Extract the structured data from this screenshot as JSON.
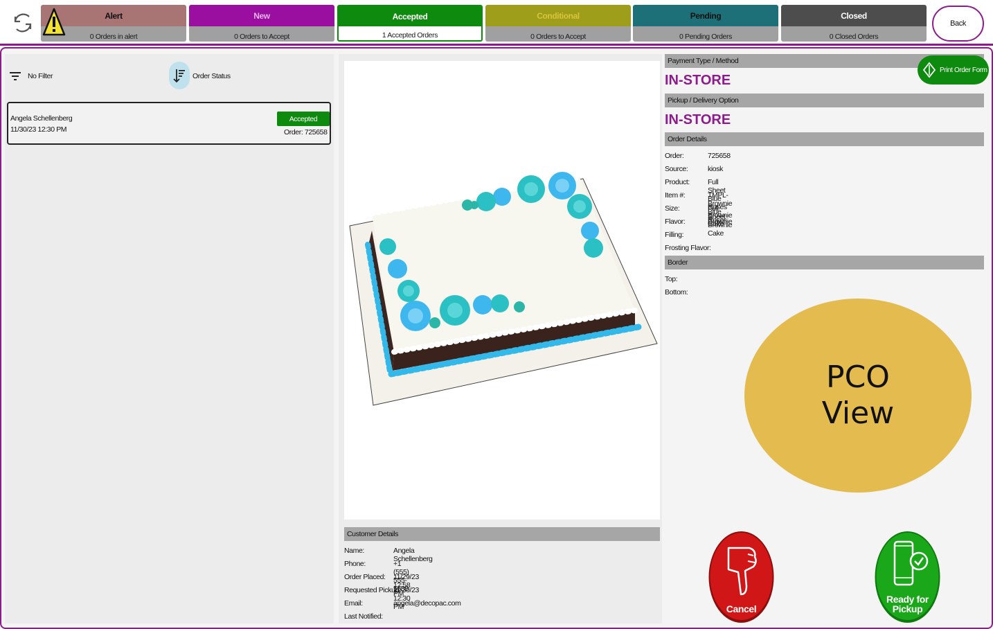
{
  "header": {
    "tiles": [
      {
        "title": "Alert",
        "subtitle": "0 Orders in alert"
      },
      {
        "title": "New",
        "subtitle": "0 Orders to Accept"
      },
      {
        "title": "Accepted",
        "subtitle": "1 Accepted Orders"
      },
      {
        "title": "Conditional",
        "subtitle": "0 Orders to Accept"
      },
      {
        "title": "Pending",
        "subtitle": "0 Pending Orders"
      },
      {
        "title": "Closed",
        "subtitle": "0 Closed Orders"
      }
    ],
    "back_label": "Back"
  },
  "filters": {
    "filter_label": "No Filter",
    "sort_label": "Order Status"
  },
  "order_list": [
    {
      "name": "Angela Schellenberg",
      "datetime": "11/30/23 12:30 PM",
      "status": "Accepted",
      "order_label": "Order: 725658"
    }
  ],
  "customer": {
    "section_title": "Customer Details",
    "rows": [
      {
        "label": "Name:",
        "value": "Angela Schellenberg"
      },
      {
        "label": "Phone:",
        "value": "+1 (555) 555-5555"
      },
      {
        "label": "Order Placed:",
        "value": "11/29/23 12:58 PM"
      },
      {
        "label": "Requested Pickup:",
        "value": "11/30/23 12:30 PM"
      },
      {
        "label": "Email:",
        "value": "angela@decopac.com"
      },
      {
        "label": "Last Notified:",
        "value": ""
      }
    ]
  },
  "details": {
    "payment_section": "Payment Type / Method",
    "payment_value": "IN-STORE",
    "pickup_section": "Pickup / Delivery Option",
    "pickup_value": "IN-STORE",
    "order_section": "Order Details",
    "order_rows": [
      {
        "label": "Order:",
        "value": "725658"
      },
      {
        "label": "Source:",
        "value": "kiosk"
      },
      {
        "label": "Product:",
        "value": "Full Sheet Blue Roses Brownie Cake"
      },
      {
        "label": "Item #:",
        "value": "TMPL-Brownie Blue Roses"
      },
      {
        "label": "Size:",
        "value": "Full Sheet Brownie Cake"
      },
      {
        "label": "Flavor:",
        "value": "Brownie"
      },
      {
        "label": "Filling:",
        "value": ""
      },
      {
        "label": "Frosting Flavor:",
        "value": ""
      }
    ],
    "border_section": "Border",
    "border_rows": [
      {
        "label": "Top:",
        "value": ""
      },
      {
        "label": "Bottom:",
        "value": ""
      }
    ]
  },
  "actions": {
    "print_label": "Print Order Form",
    "cancel_label": "Cancel",
    "ready_line1": "Ready for",
    "ready_line2": "Pickup"
  },
  "overlay": {
    "line1": "PCO",
    "line2": "View"
  },
  "colors": {
    "accent_purple": "#8e1b8e",
    "accepted_green": "#0e8a0e",
    "cancel_red": "#d01616",
    "ready_green": "#1aa81a",
    "overlay_gold": "#e3bb4f"
  }
}
